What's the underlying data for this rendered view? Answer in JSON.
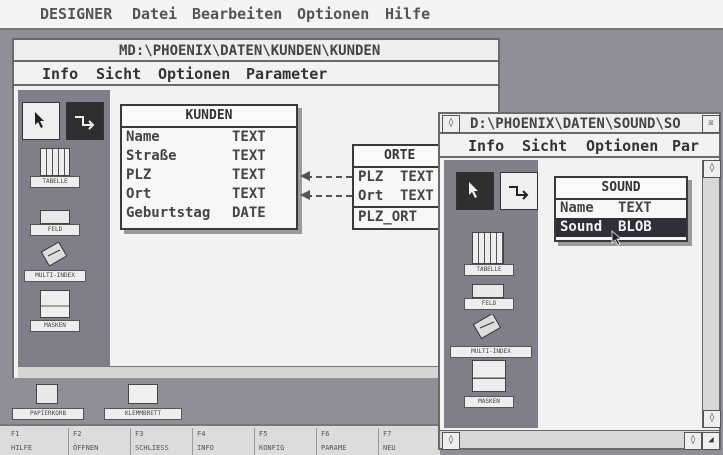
{
  "app": {
    "menu": [
      "DESIGNER",
      "Datei",
      "Bearbeiten",
      "Optionen",
      "Hilfe"
    ]
  },
  "kunden_window": {
    "title": "MD:\\PHOENIX\\DATEN\\KUNDEN\\KUNDEN",
    "menu": [
      "Info",
      "Sicht",
      "Optionen",
      "Parameter"
    ],
    "tools": [
      "TABELLE",
      "FELD",
      "MULTI-INDEX",
      "MASKEN"
    ],
    "tables": {
      "kunden": {
        "name": "KUNDEN",
        "fields": [
          {
            "name": "Name",
            "type": "TEXT"
          },
          {
            "name": "Straße",
            "type": "TEXT"
          },
          {
            "name": "PLZ",
            "type": "TEXT"
          },
          {
            "name": "Ort",
            "type": "TEXT"
          },
          {
            "name": "Geburtstag",
            "type": "DATE"
          }
        ]
      },
      "orte": {
        "name": "ORTE",
        "fields": [
          {
            "name": "PLZ",
            "type": "TEXT"
          },
          {
            "name": "Ort",
            "type": "TEXT"
          },
          {
            "name": "PLZ_ORT",
            "type": ""
          }
        ]
      }
    },
    "bottom": [
      "PAPIERKORB",
      "KLEMMBRETT"
    ]
  },
  "function_keys": [
    {
      "key": "F1",
      "label": "HILFE"
    },
    {
      "key": "F2",
      "label": "ÖFFNEN"
    },
    {
      "key": "F3",
      "label": "SCHLIESS"
    },
    {
      "key": "F4",
      "label": "INFO"
    },
    {
      "key": "F5",
      "label": "KONFIG"
    },
    {
      "key": "F6",
      "label": "PARAME"
    },
    {
      "key": "F7",
      "label": "NEU"
    }
  ],
  "sound_window": {
    "title": "D:\\PHOENIX\\DATEN\\SOUND\\SO",
    "menu": [
      "Info",
      "Sicht",
      "Optionen",
      "Par"
    ],
    "tools": [
      "TABELLE",
      "FELD",
      "MULTI-INDEX",
      "MASKEN"
    ],
    "table": {
      "name": "SOUND",
      "fields": [
        {
          "name": "Name",
          "type": "TEXT"
        },
        {
          "name": "Sound",
          "type": "BLOB"
        }
      ]
    }
  }
}
